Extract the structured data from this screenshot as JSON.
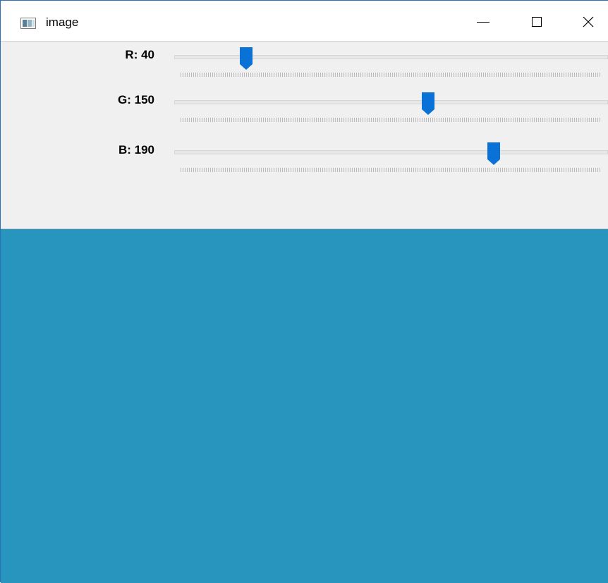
{
  "window": {
    "title": "image",
    "icon": "app-window-icon",
    "caption_icons": {
      "minimize": "minimize-icon",
      "maximize": "maximize-icon",
      "close": "close-icon"
    }
  },
  "sliders": [
    {
      "label": "R: 40",
      "value": 40,
      "max": 255,
      "color": "#0a72d6"
    },
    {
      "label": "G: 150",
      "value": 150,
      "max": 255,
      "color": "#0a72d6"
    },
    {
      "label": "B: 190",
      "value": 190,
      "max": 255,
      "color": "#0a72d6"
    }
  ],
  "preview": {
    "color": "#2895bf"
  }
}
